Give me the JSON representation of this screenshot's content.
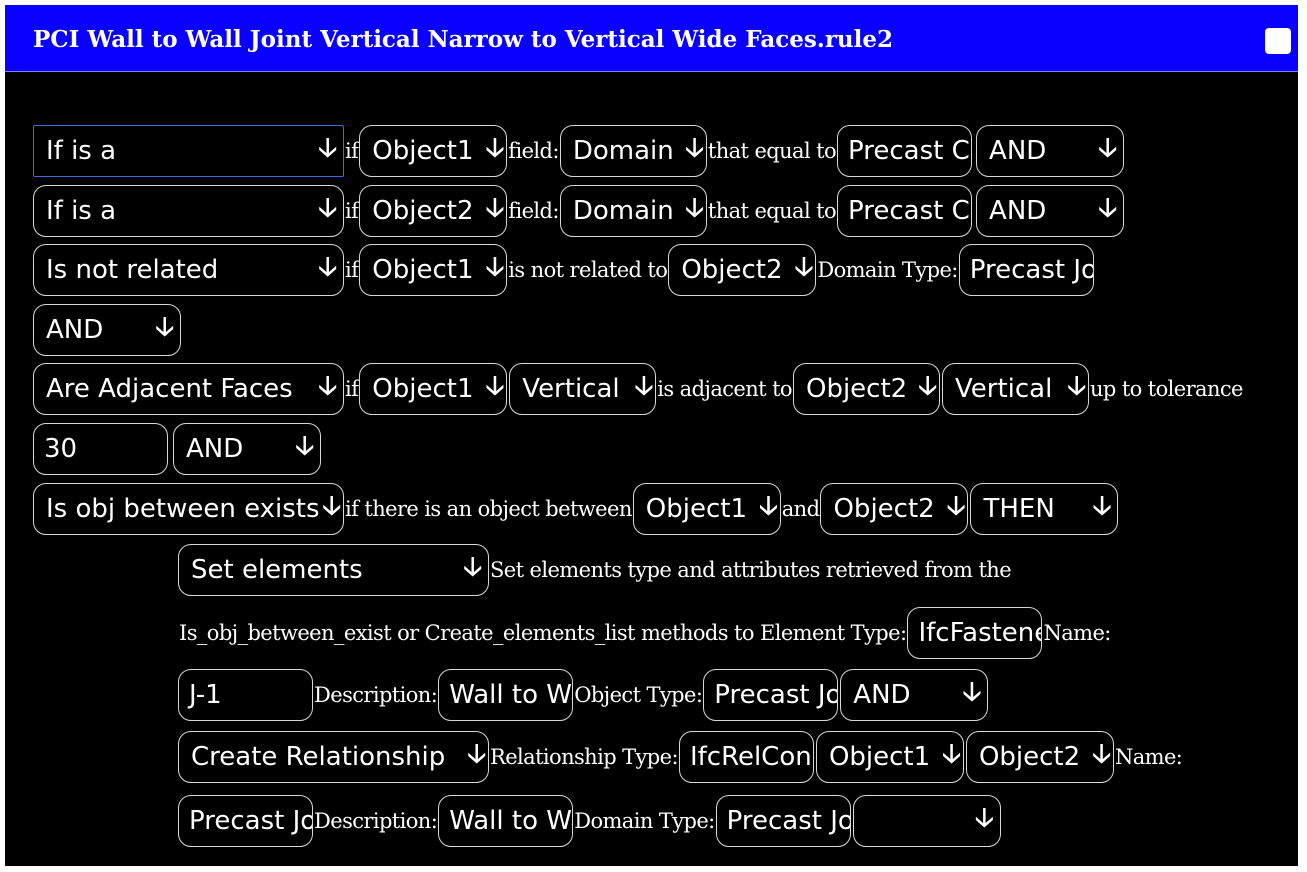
{
  "window": {
    "title": "PCI Wall to Wall Joint Vertical Narrow to Vertical Wide Faces.rule2"
  },
  "rule": {
    "r1": {
      "condition": "If is a",
      "if": "if",
      "object": "Object1",
      "field_label": "field:",
      "field": "Domain",
      "eq_label": "that equal to",
      "value": "Precast Concrete",
      "op": "AND"
    },
    "r2": {
      "condition": "If is a",
      "if": "if",
      "object": "Object2",
      "field_label": "field:",
      "field": "Domain",
      "eq_label": "that equal to",
      "value": "Precast Concrete",
      "op": "AND"
    },
    "r3": {
      "condition": "Is not related",
      "if": "if",
      "object": "Object1",
      "rel_label": "is not related to",
      "object2": "Object2",
      "domain_label": "Domain Type:",
      "domain": "Precast Joint"
    },
    "r4": {
      "op": "AND"
    },
    "r5": {
      "condition": "Are Adjacent Faces",
      "if": "if",
      "object": "Object1",
      "face1": "Vertical",
      "adj_label": "is adjacent to",
      "object2": "Object2",
      "face2": "Vertical",
      "tol_label": "up to tolerance"
    },
    "r6": {
      "tolerance": "30",
      "op": "AND"
    },
    "r7": {
      "condition": "Is obj between exists",
      "text": "if there is an object between",
      "object": "Object1",
      "and_label": "and",
      "object2": "Object2",
      "op": "THEN"
    },
    "r8": {
      "action": "Set elements",
      "text": "Set elements type and attributes retrieved from the"
    },
    "r9": {
      "text": "Is_obj_between_exist or Create_elements_list methods to Element Type:",
      "element_type": "IfcFastener",
      "name_label": "Name:"
    },
    "r10": {
      "name": "J-1",
      "desc_label": "Description:",
      "description": "Wall to Wall",
      "objtype_label": "Object Type:",
      "object_type": "Precast Joint",
      "op": "AND"
    },
    "r11": {
      "action": "Create Relationship",
      "rel_label": "Relationship Type:",
      "rel_type": "IfcRelConnects",
      "object1": "Object1",
      "object2": "Object2",
      "name_label": "Name:"
    },
    "r12": {
      "name": "Precast Joint",
      "desc_label": "Description:",
      "description": "Wall to Wall",
      "domain_label": "Domain Type:",
      "domain": "Precast Joint",
      "op": ""
    }
  }
}
